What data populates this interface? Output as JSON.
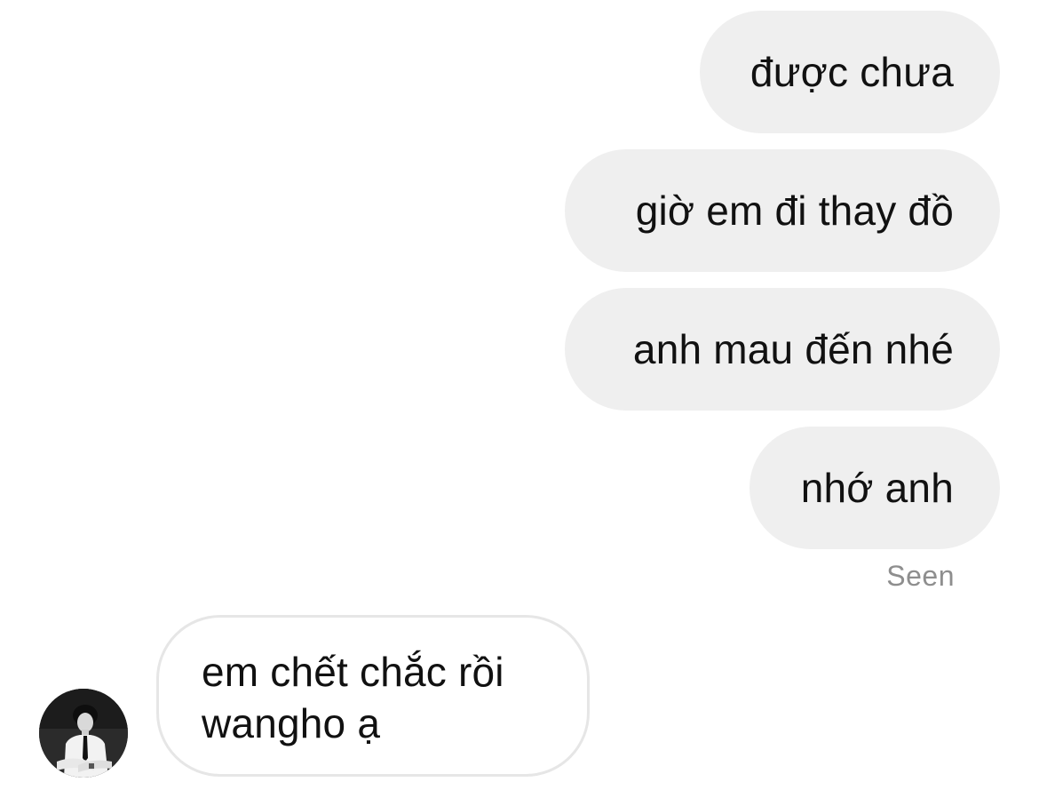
{
  "conversation": {
    "sent_messages": [
      "được chưa",
      "giờ em đi thay đồ",
      "anh mau đến nhé",
      "nhớ anh"
    ],
    "seen_label": "Seen",
    "received_message": {
      "line1": "em chết chắc rồi",
      "line2": "wangho ạ"
    }
  },
  "colors": {
    "sent_bubble": "#efefef",
    "received_border": "#e6e6e6",
    "seen_text": "#8e8e8e",
    "text": "#111111"
  },
  "icons": {
    "avatar": "profile-photo"
  }
}
